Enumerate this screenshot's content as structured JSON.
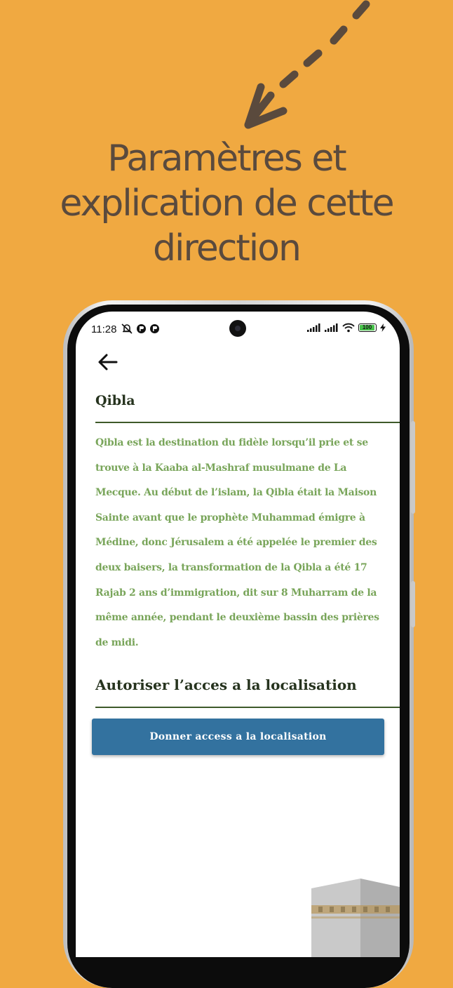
{
  "promo": {
    "headline": "Paramètres et\nexplication de cette\ndirection"
  },
  "status_bar": {
    "time": "11:28",
    "battery_level": "100",
    "battery_fraction": 1.0
  },
  "screen": {
    "section_qibla_title": "Qibla",
    "qibla_description": "Qibla est la destination du fidèle lorsqu’il prie et se trouve à la Kaaba al-Mashraf musulmane de La Mecque. Au début de l’islam, la Qibla était la Maison Sainte avant que le prophète Muhammad émigre à Médine, donc Jérusalem a été appelée le premier des deux baisers, la transformation de la Qibla a été 17 Rajab 2 ans d’immigration, dit sur 8 Muharram de la même année, pendant le deuxième bassin des prières de midi.",
    "section_location_title": "Autoriser l’acces a la localisation",
    "location_button_label": "Donner access a la localisation"
  },
  "icons": {
    "back": "arrow-left-icon",
    "decorative_arrow": "dashed-arrow-icon",
    "kaaba": "kaaba-icon"
  },
  "colors": {
    "background": "#f0a941",
    "headline": "#5a4a3d",
    "title_text": "#26331e",
    "body_text": "#79a55a",
    "divider": "#3e5a2a",
    "button": "#33729f",
    "battery": "#47c24a"
  }
}
